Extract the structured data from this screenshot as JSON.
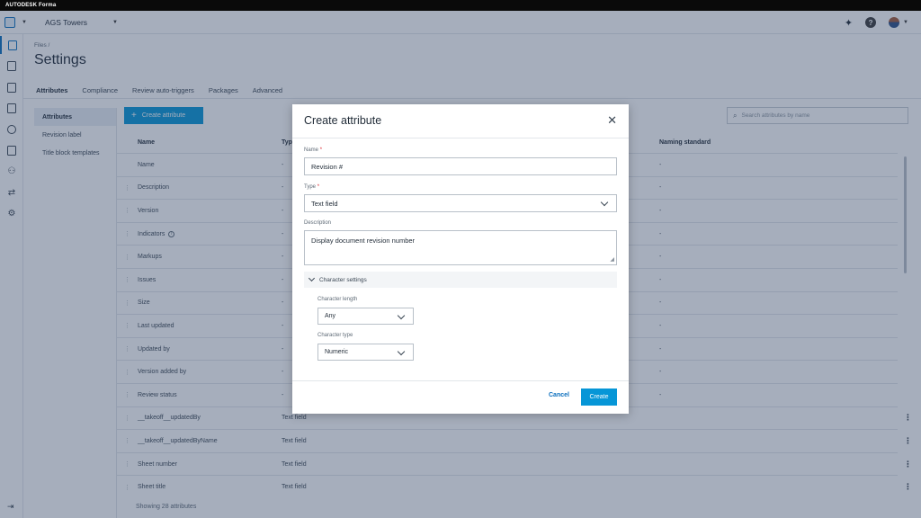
{
  "brand": {
    "name": "AUTODESK Forma"
  },
  "header": {
    "project_name": "AGS Towers"
  },
  "rail": {
    "items": [
      "files-icon",
      "sheets-icon",
      "reviews-icon",
      "packages-icon",
      "approvals-icon",
      "reports-icon",
      "members-icon",
      "transmittals-icon",
      "settings-icon"
    ]
  },
  "page": {
    "breadcrumb": "Files  /",
    "title": "Settings",
    "tabs": [
      "Attributes",
      "Compliance",
      "Review auto-triggers",
      "Packages",
      "Advanced"
    ],
    "active_tab": "Attributes"
  },
  "subnav": {
    "items": [
      "Attributes",
      "Revision label",
      "Title block templates"
    ],
    "active": "Attributes"
  },
  "toolbar": {
    "create_label": "Create attribute",
    "search_placeholder": "Search attributes by name"
  },
  "table": {
    "headers": {
      "name": "Name",
      "type": "Typ",
      "naming": "Naming standard"
    },
    "rows": [
      {
        "name": "Name",
        "type": "-",
        "naming": "-",
        "handle": false,
        "info": false,
        "menu": false
      },
      {
        "name": "Description",
        "type": "-",
        "naming": "-",
        "handle": true,
        "info": false,
        "menu": false
      },
      {
        "name": "Version",
        "type": "-",
        "naming": "-",
        "handle": true,
        "info": false,
        "menu": false
      },
      {
        "name": "Indicators",
        "type": "-",
        "naming": "-",
        "handle": true,
        "info": true,
        "menu": false
      },
      {
        "name": "Markups",
        "type": "-",
        "naming": "-",
        "handle": true,
        "info": false,
        "menu": false
      },
      {
        "name": "Issues",
        "type": "-",
        "naming": "-",
        "handle": true,
        "info": false,
        "menu": false
      },
      {
        "name": "Size",
        "type": "-",
        "naming": "-",
        "handle": true,
        "info": false,
        "menu": false
      },
      {
        "name": "Last updated",
        "type": "-",
        "naming": "-",
        "handle": true,
        "info": false,
        "menu": false
      },
      {
        "name": "Updated by",
        "type": "-",
        "naming": "-",
        "handle": true,
        "info": false,
        "menu": false
      },
      {
        "name": "Version added by",
        "type": "-",
        "naming": "-",
        "handle": true,
        "info": false,
        "menu": false
      },
      {
        "name": "Review status",
        "type": "-",
        "naming": "-",
        "handle": true,
        "info": false,
        "menu": false
      },
      {
        "name": "__takeoff__updatedBy",
        "type": "Text field",
        "naming": "",
        "handle": true,
        "info": false,
        "menu": true
      },
      {
        "name": "__takeoff__updatedByName",
        "type": "Text field",
        "naming": "",
        "handle": true,
        "info": false,
        "menu": true
      },
      {
        "name": "Sheet number",
        "type": "Text field",
        "naming": "",
        "handle": true,
        "info": false,
        "menu": true
      },
      {
        "name": "Sheet title",
        "type": "Text field",
        "naming": "",
        "handle": true,
        "info": false,
        "menu": true
      }
    ],
    "footer": "Showing 28 attributes"
  },
  "modal": {
    "title": "Create attribute",
    "name_label": "Name",
    "name_value": "Revision #",
    "type_label": "Type",
    "type_value": "Text field",
    "description_label": "Description",
    "description_value": "Display document revision number",
    "section_label": "Character settings",
    "char_length_label": "Character length",
    "char_length_value": "Any",
    "char_type_label": "Character type",
    "char_type_value": "Numeric",
    "cancel_label": "Cancel",
    "create_label": "Create",
    "required_mark": "*"
  },
  "colors": {
    "accent": "#0696d7",
    "link": "#0a6ebd",
    "required": "#d9262c",
    "overlay": "#2a3f5f"
  }
}
